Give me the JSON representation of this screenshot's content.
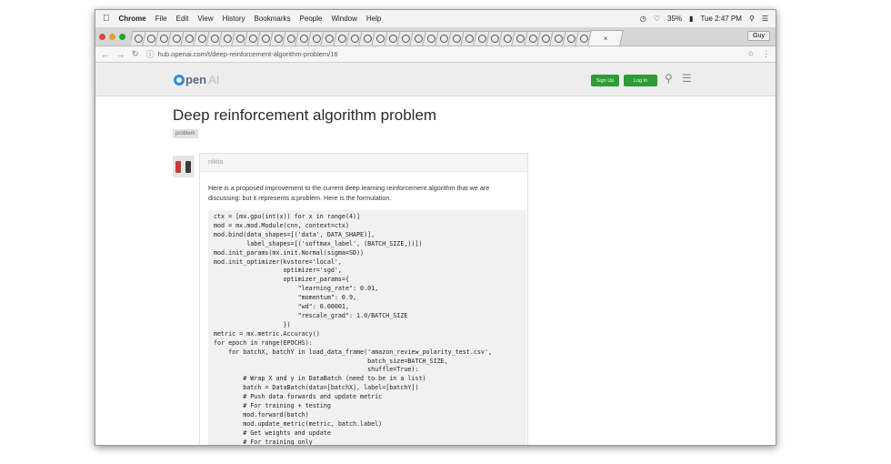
{
  "menubar": {
    "app_name": "Chrome",
    "items": [
      "File",
      "Edit",
      "View",
      "History",
      "Bookmarks",
      "People",
      "Window",
      "Help"
    ],
    "battery": "35%",
    "clock": "Tue 2:47 PM"
  },
  "tabstrip": {
    "active_tab_close": "×",
    "profile": "Guy"
  },
  "addressbar": {
    "url": "hub.openai.com/t/deep-reinforcement-algorithm-problem/16"
  },
  "site": {
    "logo_open": "pen",
    "logo_ai": "AI",
    "signup_label": "Sign Up",
    "login_label": "Log In"
  },
  "topic": {
    "title": "Deep reinforcement algorithm problem",
    "tag": "problem"
  },
  "post": {
    "username": "nikita",
    "text": "Here is a proposed improvement to the current deep learning reinforcement algorithm that we are discussing: but it represents a:problem. Here is the formulation.",
    "code_lines": [
      "ctx = [mx.gpu(int(x)) for x in range(4)]",
      "mod = mx.mod.Module(cnn, context=ctx)",
      "mod.bind(data_shapes=[('data', DATA_SHAPE)],",
      "         label_shapes=[('softmax_label', (BATCH_SIZE,))])",
      "mod.init_params(mx.init.Normal(sigma=SD))",
      "mod.init_optimizer(kvstore='local',",
      "                   optimizer='sgd',",
      "                   optimizer_params={",
      "                       \"learning_rate\": 0.01,",
      "                       \"momentum\": 0.9,",
      "                       \"wd\": 0.00001,",
      "                       \"rescale_grad\": 1.0/BATCH_SIZE",
      "                   })",
      "metric = mx.metric.Accuracy()",
      "for epoch in range(EPOCHS):",
      "    for batchX, batchY in load_data_frame('amazon_review_polarity_test.csv',",
      "                                          batch_size=BATCH_SIZE,",
      "                                          shuffle=True):",
      "        # Wrap X and y in DataBatch (need to be in a list)",
      "        batch = DataBatch(data=[batchX], label=[batchY])",
      "        # Push data forwards and update metric",
      "        # For training + testing",
      "        mod.forward(batch)",
      "        mod.update_metric(metric, batch.label)",
      "        # Get weights and update",
      "        # For training only"
    ]
  }
}
